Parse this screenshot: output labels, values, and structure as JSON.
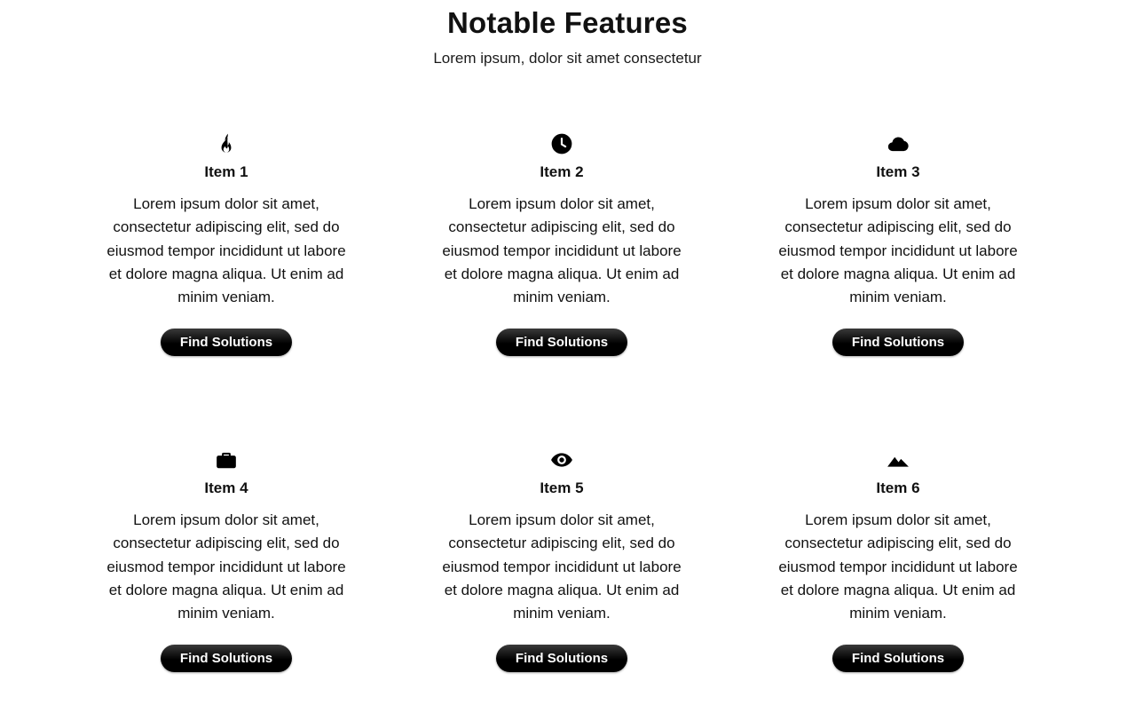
{
  "header": {
    "title": "Notable Features",
    "subtitle": "Lorem ipsum, dolor sit amet consectetur"
  },
  "items": [
    {
      "icon": "fire-icon",
      "title": "Item 1",
      "text": "Lorem ipsum dolor sit amet, consectetur adipiscing elit, sed do eiusmod tempor incididunt ut labore et dolore magna aliqua. Ut enim ad minim veniam.",
      "button": "Find Solutions"
    },
    {
      "icon": "clock-icon",
      "title": "Item 2",
      "text": "Lorem ipsum dolor sit amet, consectetur adipiscing elit, sed do eiusmod tempor incididunt ut labore et dolore magna aliqua. Ut enim ad minim veniam.",
      "button": "Find Solutions"
    },
    {
      "icon": "cloud-icon",
      "title": "Item 3",
      "text": "Lorem ipsum dolor sit amet, consectetur adipiscing elit, sed do eiusmod tempor incididunt ut labore et dolore magna aliqua. Ut enim ad minim veniam.",
      "button": "Find Solutions"
    },
    {
      "icon": "briefcase-icon",
      "title": "Item 4",
      "text": "Lorem ipsum dolor sit amet, consectetur adipiscing elit, sed do eiusmod tempor incididunt ut labore et dolore magna aliqua. Ut enim ad minim veniam.",
      "button": "Find Solutions"
    },
    {
      "icon": "eye-icon",
      "title": "Item 5",
      "text": "Lorem ipsum dolor sit amet, consectetur adipiscing elit, sed do eiusmod tempor incididunt ut labore et dolore magna aliqua. Ut enim ad minim veniam.",
      "button": "Find Solutions"
    },
    {
      "icon": "mountain-icon",
      "title": "Item 6",
      "text": "Lorem ipsum dolor sit amet, consectetur adipiscing elit, sed do eiusmod tempor incididunt ut labore et dolore magna aliqua. Ut enim ad minim veniam.",
      "button": "Find Solutions"
    }
  ],
  "colors": {
    "button_bg": "#000000",
    "button_text": "#ffffff",
    "text": "#111111"
  }
}
